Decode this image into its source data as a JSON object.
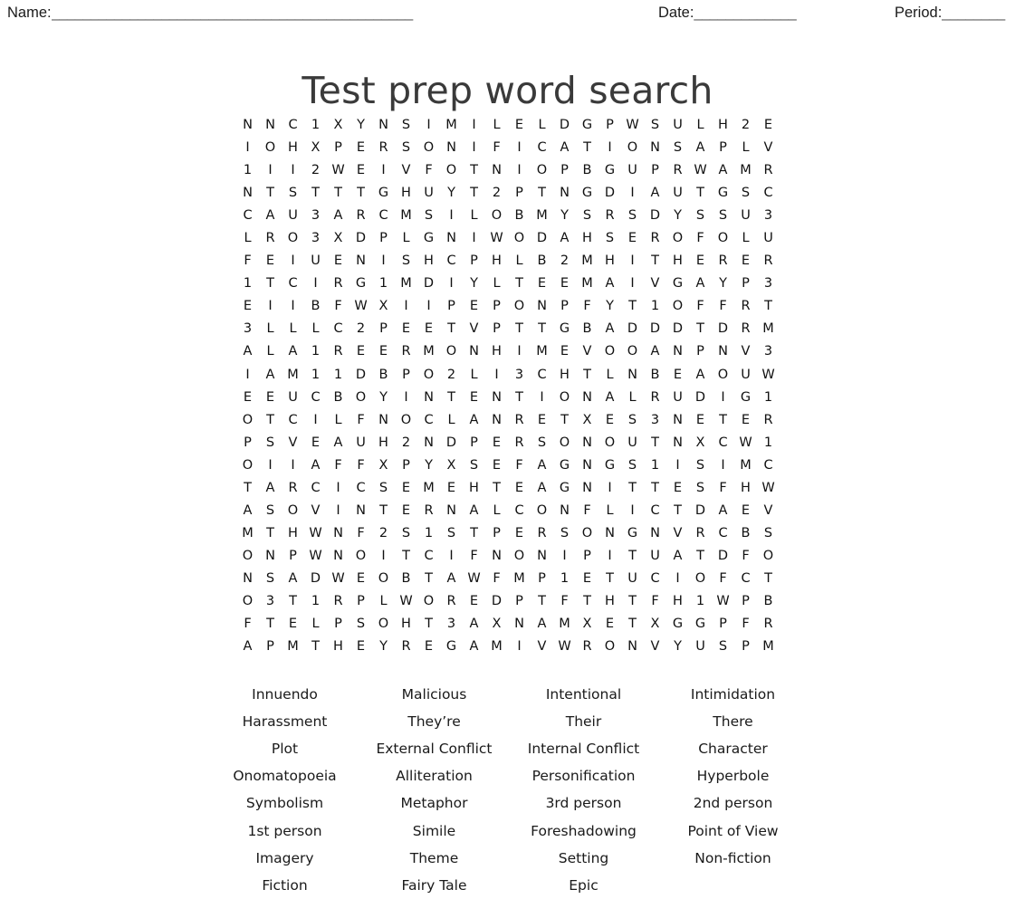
{
  "header": {
    "name_label": "Name:",
    "name_rule": "______________________________________________",
    "date_label": "Date:",
    "date_rule": "_____________",
    "period_label": "Period:",
    "period_rule": "________"
  },
  "title": "Test prep word search",
  "grid": {
    "rows": 24,
    "cols": 24,
    "letters": [
      [
        "N",
        "N",
        "C",
        "1",
        "X",
        "Y",
        "N",
        "S",
        "I",
        "M",
        "I",
        "L",
        "E",
        "L",
        "D",
        "G",
        "P",
        "W",
        "S",
        "U",
        "L",
        "H",
        "2",
        "E"
      ],
      [
        "I",
        "O",
        "H",
        "X",
        "P",
        "E",
        "R",
        "S",
        "O",
        "N",
        "I",
        "F",
        "I",
        "C",
        "A",
        "T",
        "I",
        "O",
        "N",
        "S",
        "A",
        "P",
        "L",
        "V"
      ],
      [
        "1",
        "I",
        "I",
        "2",
        "W",
        "E",
        "I",
        "V",
        "F",
        "O",
        "T",
        "N",
        "I",
        "O",
        "P",
        "B",
        "G",
        "U",
        "P",
        "R",
        "W",
        "A",
        "M",
        "R"
      ],
      [
        "N",
        "T",
        "S",
        "T",
        "T",
        "T",
        "G",
        "H",
        "U",
        "Y",
        "T",
        "2",
        "P",
        "T",
        "N",
        "G",
        "D",
        "I",
        "A",
        "U",
        "T",
        "G",
        "S",
        "C"
      ],
      [
        "C",
        "A",
        "U",
        "3",
        "A",
        "R",
        "C",
        "M",
        "S",
        "I",
        "L",
        "O",
        "B",
        "M",
        "Y",
        "S",
        "R",
        "S",
        "D",
        "Y",
        "S",
        "S",
        "U",
        "3"
      ],
      [
        "L",
        "R",
        "O",
        "3",
        "X",
        "D",
        "P",
        "L",
        "G",
        "N",
        "I",
        "W",
        "O",
        "D",
        "A",
        "H",
        "S",
        "E",
        "R",
        "O",
        "F",
        "O",
        "L",
        "U"
      ],
      [
        "F",
        "E",
        "I",
        "U",
        "E",
        "N",
        "I",
        "S",
        "H",
        "C",
        "P",
        "H",
        "L",
        "B",
        "2",
        "M",
        "H",
        "I",
        "T",
        "H",
        "E",
        "R",
        "E",
        "R"
      ],
      [
        "1",
        "T",
        "C",
        "I",
        "R",
        "G",
        "1",
        "M",
        "D",
        "I",
        "Y",
        "L",
        "T",
        "E",
        "E",
        "M",
        "A",
        "I",
        "V",
        "G",
        "A",
        "Y",
        "P",
        "3"
      ],
      [
        "E",
        "I",
        "I",
        "B",
        "F",
        "W",
        "X",
        "I",
        "I",
        "P",
        "E",
        "P",
        "O",
        "N",
        "P",
        "F",
        "Y",
        "T",
        "1",
        "O",
        "F",
        "F",
        "R",
        "T"
      ],
      [
        "3",
        "L",
        "L",
        "L",
        "C",
        "2",
        "P",
        "E",
        "E",
        "T",
        "V",
        "P",
        "T",
        "T",
        "G",
        "B",
        "A",
        "D",
        "D",
        "D",
        "T",
        "D",
        "R",
        "M"
      ],
      [
        "A",
        "L",
        "A",
        "1",
        "R",
        "E",
        "E",
        "R",
        "M",
        "O",
        "N",
        "H",
        "I",
        "M",
        "E",
        "V",
        "O",
        "O",
        "A",
        "N",
        "P",
        "N",
        "V",
        "3"
      ],
      [
        "I",
        "A",
        "M",
        "1",
        "1",
        "D",
        "B",
        "P",
        "O",
        "2",
        "L",
        "I",
        "3",
        "C",
        "H",
        "T",
        "L",
        "N",
        "B",
        "E",
        "A",
        "O",
        "U",
        "W"
      ],
      [
        "E",
        "E",
        "U",
        "C",
        "B",
        "O",
        "Y",
        "I",
        "N",
        "T",
        "E",
        "N",
        "T",
        "I",
        "O",
        "N",
        "A",
        "L",
        "R",
        "U",
        "D",
        "I",
        "G",
        "1"
      ],
      [
        "O",
        "T",
        "C",
        "I",
        "L",
        "F",
        "N",
        "O",
        "C",
        "L",
        "A",
        "N",
        "R",
        "E",
        "T",
        "X",
        "E",
        "S",
        "3",
        "N",
        "E",
        "T",
        "E",
        "R"
      ],
      [
        "P",
        "S",
        "V",
        "E",
        "A",
        "U",
        "H",
        "2",
        "N",
        "D",
        "P",
        "E",
        "R",
        "S",
        "O",
        "N",
        "O",
        "U",
        "T",
        "N",
        "X",
        "C",
        "W",
        "1"
      ],
      [
        "O",
        "I",
        "I",
        "A",
        "F",
        "F",
        "X",
        "P",
        "Y",
        "X",
        "S",
        "E",
        "F",
        "A",
        "G",
        "N",
        "G",
        "S",
        "1",
        "I",
        "S",
        "I",
        "M",
        "C"
      ],
      [
        "T",
        "A",
        "R",
        "C",
        "I",
        "C",
        "S",
        "E",
        "M",
        "E",
        "H",
        "T",
        "E",
        "A",
        "G",
        "N",
        "I",
        "T",
        "T",
        "E",
        "S",
        "F",
        "H",
        "W"
      ],
      [
        "A",
        "S",
        "O",
        "V",
        "I",
        "N",
        "T",
        "E",
        "R",
        "N",
        "A",
        "L",
        "C",
        "O",
        "N",
        "F",
        "L",
        "I",
        "C",
        "T",
        "D",
        "A",
        "E",
        "V"
      ],
      [
        "M",
        "T",
        "H",
        "W",
        "N",
        "F",
        "2",
        "S",
        "1",
        "S",
        "T",
        "P",
        "E",
        "R",
        "S",
        "O",
        "N",
        "G",
        "N",
        "V",
        "R",
        "C",
        "B",
        "S"
      ],
      [
        "O",
        "N",
        "P",
        "W",
        "N",
        "O",
        "I",
        "T",
        "C",
        "I",
        "F",
        "N",
        "O",
        "N",
        "I",
        "P",
        "I",
        "T",
        "U",
        "A",
        "T",
        "D",
        "F",
        "O"
      ],
      [
        "N",
        "S",
        "A",
        "D",
        "W",
        "E",
        "O",
        "B",
        "T",
        "A",
        "W",
        "F",
        "M",
        "P",
        "1",
        "E",
        "T",
        "U",
        "C",
        "I",
        "O",
        "F",
        "C",
        "T"
      ],
      [
        "O",
        "3",
        "T",
        "1",
        "R",
        "P",
        "L",
        "W",
        "O",
        "R",
        "E",
        "D",
        "P",
        "T",
        "F",
        "T",
        "H",
        "T",
        "F",
        "H",
        "1",
        "W",
        "P",
        "B"
      ],
      [
        "F",
        "T",
        "E",
        "L",
        "P",
        "S",
        "O",
        "H",
        "T",
        "3",
        "A",
        "X",
        "N",
        "A",
        "M",
        "X",
        "E",
        "T",
        "X",
        "G",
        "G",
        "P",
        "F",
        "R"
      ],
      [
        "A",
        "P",
        "M",
        "T",
        "H",
        "E",
        "Y",
        "R",
        "E",
        "G",
        "A",
        "M",
        "I",
        "V",
        "W",
        "R",
        "O",
        "N",
        "V",
        "Y",
        "U",
        "S",
        "P",
        "M"
      ]
    ]
  },
  "word_list": {
    "columns": 4,
    "rows": [
      [
        "Innuendo",
        "Malicious",
        "Intentional",
        "Intimidation"
      ],
      [
        "Harassment",
        "They’re",
        "Their",
        "There"
      ],
      [
        "Plot",
        "External Conflict",
        "Internal Conflict",
        "Character"
      ],
      [
        "Onomatopoeia",
        "Alliteration",
        "Personification",
        "Hyperbole"
      ],
      [
        "Symbolism",
        "Metaphor",
        "3rd person",
        "2nd person"
      ],
      [
        "1st person",
        "Simile",
        "Foreshadowing",
        "Point of View"
      ],
      [
        "Imagery",
        "Theme",
        "Setting",
        "Non-fiction"
      ],
      [
        "Fiction",
        "Fairy Tale",
        "Epic",
        ""
      ]
    ]
  }
}
